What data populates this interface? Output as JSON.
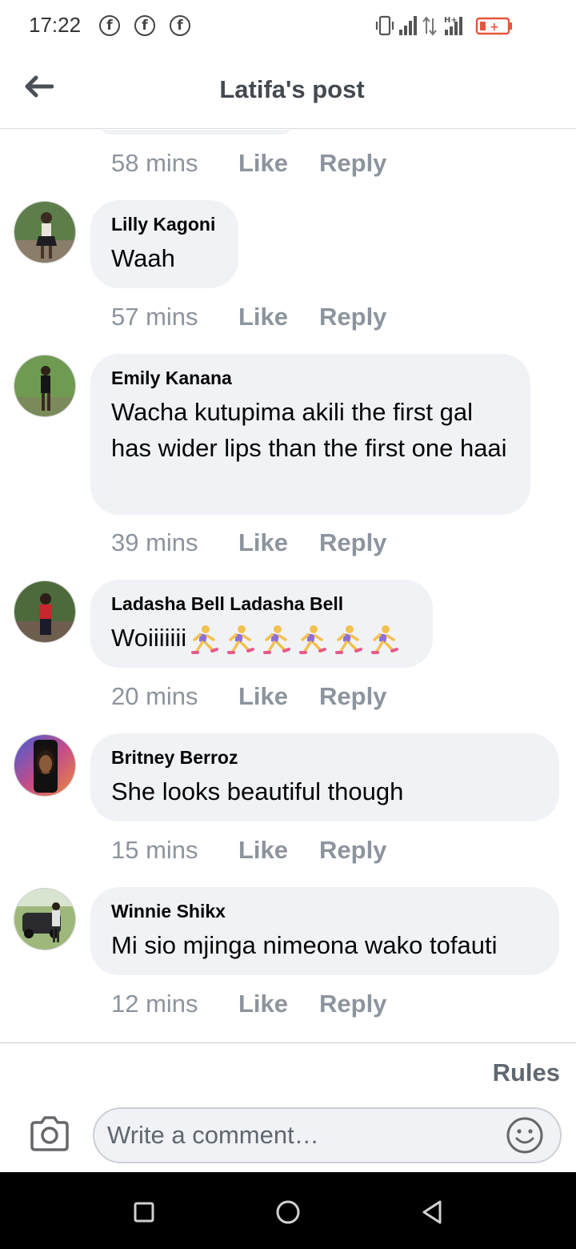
{
  "status_bar": {
    "time": "17:22",
    "notification_icons": [
      "facebook-icon",
      "facebook-icon",
      "facebook-icon"
    ],
    "right_icons": [
      "vibrate-icon",
      "signal-icon",
      "data-arrows-icon",
      "hplus-signal-icon",
      "battery-low-icon"
    ],
    "network_label": "H+",
    "battery_color": "#e8553e"
  },
  "header": {
    "title": "Latifa's post"
  },
  "top_meta": {
    "time": "58 mins",
    "like": "Like",
    "reply": "Reply"
  },
  "comments": [
    {
      "author": "Lilly Kagoni",
      "text": "Waah",
      "time": "57 mins",
      "like": "Like",
      "reply": "Reply"
    },
    {
      "author": "Emily Kanana",
      "text": "Wacha kutupima akili the first gal has wider lips than the first one haai",
      "time": "39 mins",
      "like": "Like",
      "reply": "Reply"
    },
    {
      "author": "Ladasha Bell Ladasha Bell",
      "text": "Woiiiiiii",
      "emoji": [
        "woman-running-icon",
        "woman-running-icon",
        "woman-running-icon",
        "woman-running-icon",
        "woman-running-icon",
        "woman-running-icon"
      ],
      "time": "20 mins",
      "like": "Like",
      "reply": "Reply"
    },
    {
      "author": "Britney Berroz",
      "text": "She looks beautiful though",
      "time": "15 mins",
      "like": "Like",
      "reply": "Reply"
    },
    {
      "author": "Winnie Shikx",
      "text": "Mi sio mjinga nimeona wako tofauti",
      "time": "12 mins",
      "like": "Like",
      "reply": "Reply"
    }
  ],
  "footer": {
    "rules": "Rules",
    "comment_placeholder": "Write a comment…"
  },
  "colors": {
    "bubble_bg": "#f0f2f5",
    "meta_text": "#8d949e",
    "title_text": "#444950"
  }
}
